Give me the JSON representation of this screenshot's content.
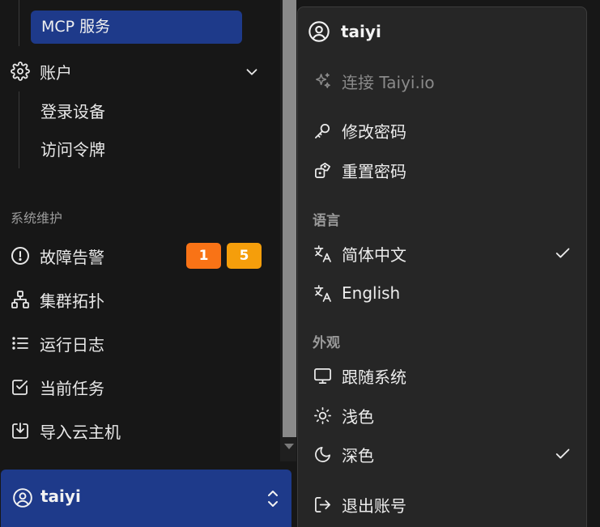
{
  "sidebar": {
    "mcp_label": "MCP 服务",
    "account": {
      "label": "账户",
      "children": [
        "登录设备",
        "访问令牌"
      ]
    },
    "section_label": "系统维护",
    "items": [
      {
        "label": "故障告警",
        "icon": "alert-circle-icon"
      },
      {
        "label": "集群拓扑",
        "icon": "network-icon"
      },
      {
        "label": "运行日志",
        "icon": "list-icon"
      },
      {
        "label": "当前任务",
        "icon": "check-square-icon"
      },
      {
        "label": "导入云主机",
        "icon": "import-icon"
      }
    ],
    "badges": [
      {
        "value": "1",
        "color": "#f97316"
      },
      {
        "value": "5",
        "color": "#f59e0b"
      }
    ],
    "user": {
      "name": "taiyi"
    }
  },
  "menu": {
    "username": "taiyi",
    "connect_label": "连接 Taiyi.io",
    "change_password": "修改密码",
    "reset_password": "重置密码",
    "language_section": "语言",
    "languages": [
      {
        "label": "简体中文",
        "selected": true
      },
      {
        "label": "English",
        "selected": false
      }
    ],
    "appearance_section": "外观",
    "themes": [
      {
        "label": "跟随系统",
        "selected": false
      },
      {
        "label": "浅色",
        "selected": false
      },
      {
        "label": "深色",
        "selected": true
      }
    ],
    "logout": "退出账号"
  },
  "colors": {
    "accent": "#1e3a8a",
    "menu_bg": "#262626",
    "sidebar_bg": "#171717"
  }
}
